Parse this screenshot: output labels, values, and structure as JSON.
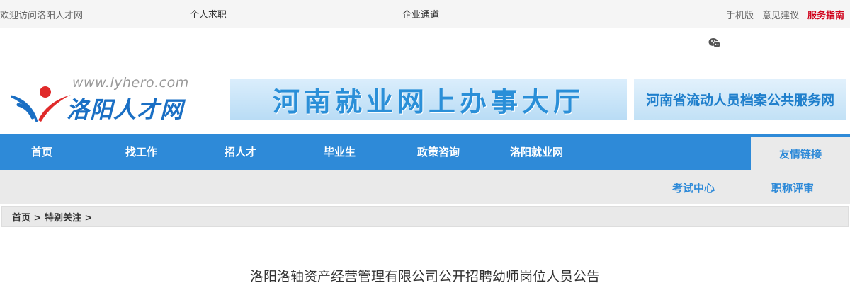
{
  "topbar": {
    "welcome": "欢迎访问洛阳人才网",
    "personal": "个人求职",
    "company": "企业通道",
    "mobile": "手机版",
    "feedback": "意见建议",
    "service": "服务指南"
  },
  "icons": {
    "wechat": "wechat-icon"
  },
  "header": {
    "logo_url": "www.lyhero.com",
    "logo_name": "洛阳人才网",
    "banner1": "河南就业网上办事大厅",
    "banner2": "河南省流动人员档案公共服务网"
  },
  "nav": {
    "items": [
      "首页",
      "找工作",
      "招人才",
      "毕业生",
      "政策咨询",
      "洛阳就业网"
    ],
    "friend": "友情链接"
  },
  "subnav": {
    "exam": "考试中心",
    "title_review": "职称评审"
  },
  "breadcrumb": {
    "home": "首页",
    "sep": ">",
    "section": "特别关注"
  },
  "article": {
    "title": "洛阳洛轴资产经营管理有限公司公开招聘幼师岗位人员公告"
  },
  "colors": {
    "nav_blue": "#2e8ad8",
    "service_red": "#d0021b",
    "logo_blue": "#1a6fc4"
  }
}
